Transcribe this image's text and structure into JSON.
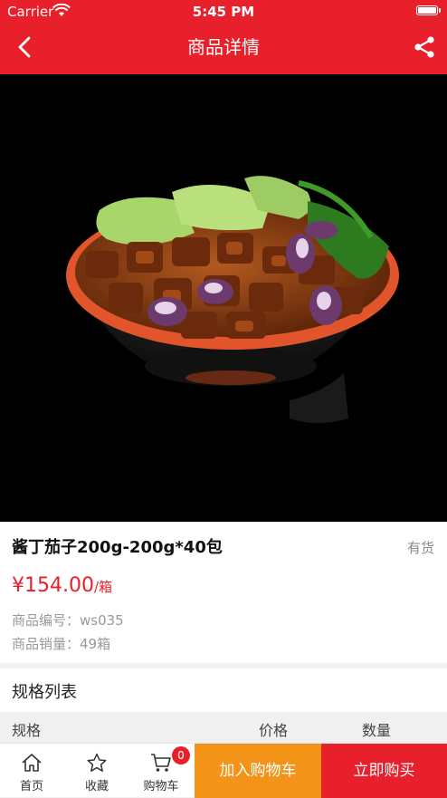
{
  "status_bar": {
    "carrier": "Carrier",
    "time": "5:45 PM"
  },
  "header": {
    "title": "商品详情",
    "back_icon": "chevron-left-icon",
    "share_icon": "share-icon"
  },
  "product": {
    "name": "酱丁茄子200g-200g*40包",
    "stock": "有货",
    "price": "¥154.00",
    "price_unit": "/箱",
    "code_label": "商品编号：",
    "code": "ws035",
    "sales_label": "商品销量：",
    "sales": "49箱"
  },
  "spec": {
    "title": "规格列表",
    "columns": [
      "规格",
      "价格",
      "数量"
    ]
  },
  "tabbar": {
    "home": "首页",
    "favorite": "收藏",
    "cart": "购物车",
    "cart_badge": "0",
    "add_to_cart": "加入购物车",
    "buy_now": "立即购买"
  },
  "colors": {
    "brand": "#e7202b",
    "orange": "#f39418"
  }
}
